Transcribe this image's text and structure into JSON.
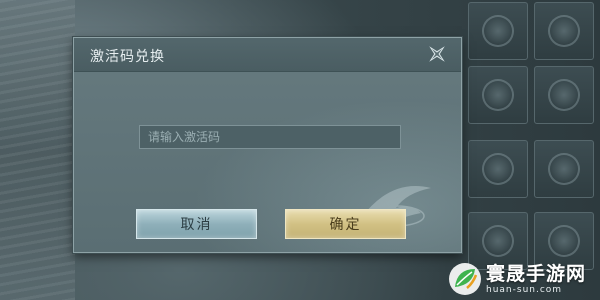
{
  "dialog": {
    "title": "激活码兑换",
    "input": {
      "placeholder": "请输入激活码",
      "value": ""
    },
    "cancel_label": "取消",
    "confirm_label": "确定"
  },
  "watermark": {
    "name": "寰晟手游网",
    "url": "huan-sun.com"
  },
  "icons": {
    "close": "close-icon",
    "watermark_logo": "leaf-logo-icon",
    "background_slots": "item-slot-icon"
  },
  "colors": {
    "dialog_bg": "#5f7378",
    "cancel_button": "#9dbcc5",
    "confirm_button": "#d6c78c",
    "title_text": "#e7eef0"
  }
}
